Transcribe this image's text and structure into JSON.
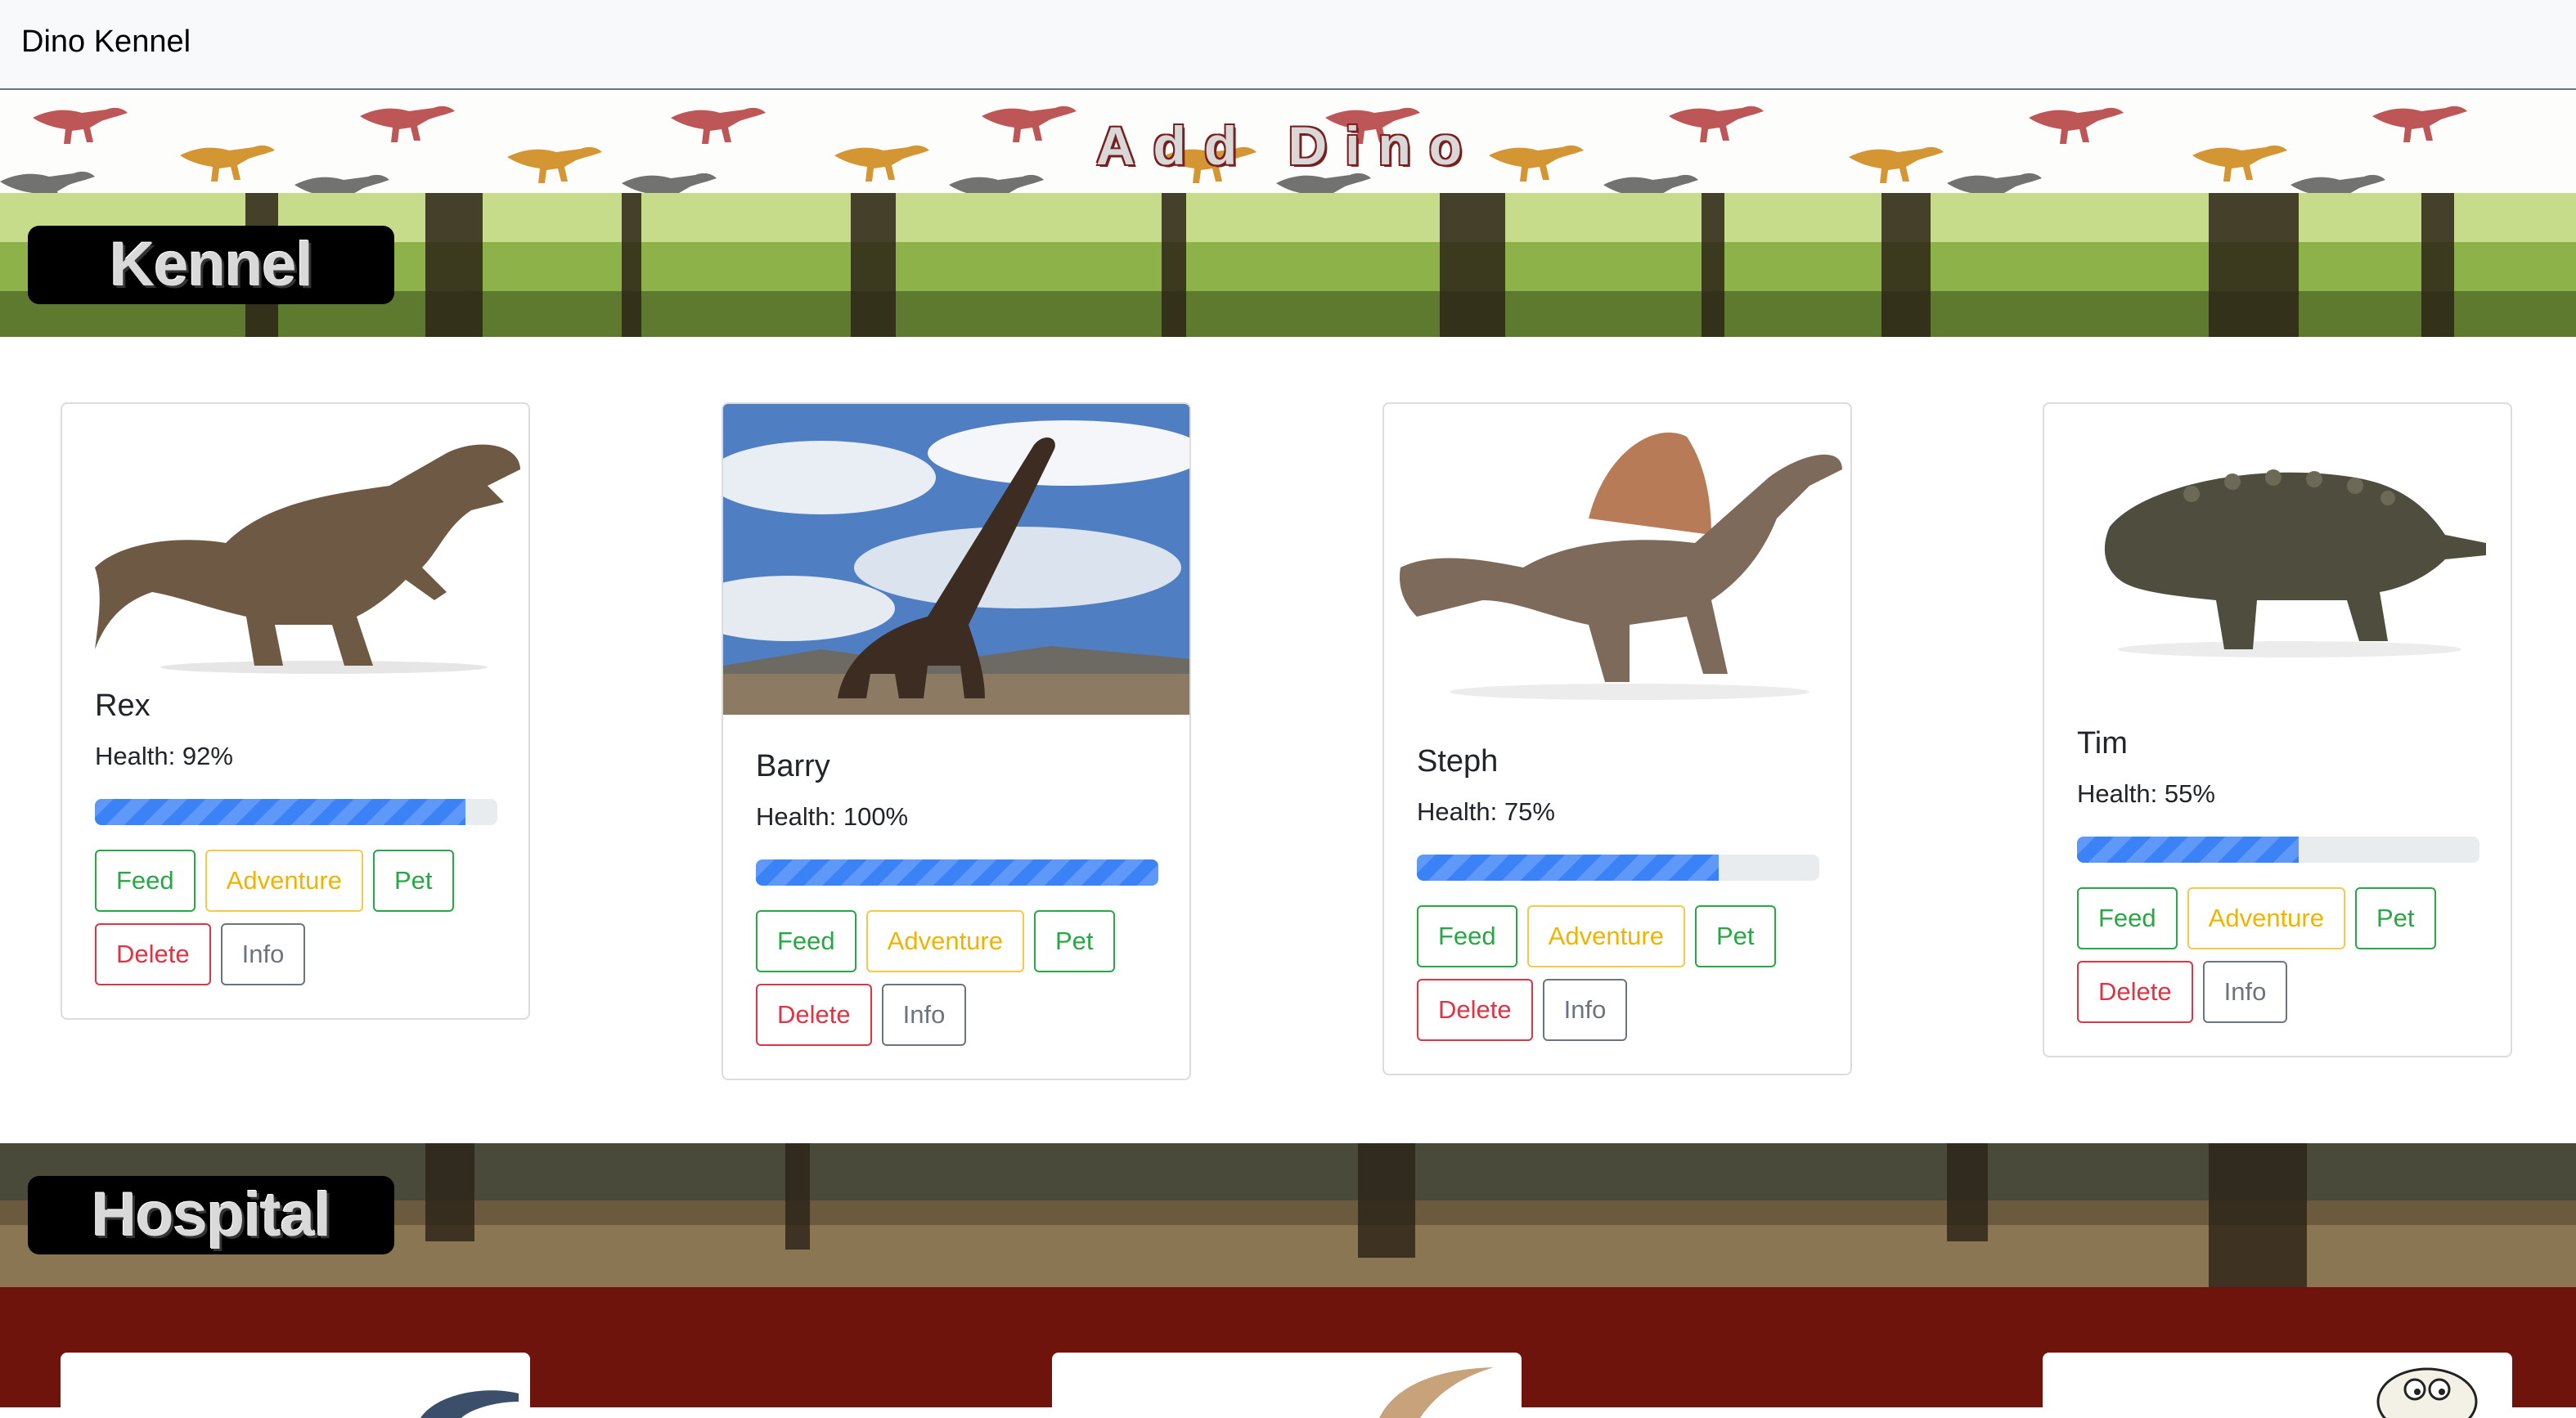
{
  "nav": {
    "brand": "Dino Kennel"
  },
  "add_dino": {
    "label": "Add Dino"
  },
  "kennel": {
    "title": "Kennel",
    "dinos": [
      {
        "name": "Rex",
        "health_text": "Health: 92%",
        "health": 92,
        "image": "t-rex-icon"
      },
      {
        "name": "Barry",
        "health_text": "Health: 100%",
        "health": 100,
        "image": "brachiosaurus-photo-icon"
      },
      {
        "name": "Steph",
        "health_text": "Health: 75%",
        "health": 75,
        "image": "spinosaurus-icon"
      },
      {
        "name": "Tim",
        "health_text": "Health: 55%",
        "health": 55,
        "image": "ankylosaurus-icon"
      }
    ]
  },
  "buttons": {
    "feed": "Feed",
    "adventure": "Adventure",
    "pet": "Pet",
    "delete": "Delete",
    "info": "Info"
  },
  "hospital": {
    "title": "Hospital"
  },
  "colors": {
    "primary": "#3b82f6",
    "success": "#28a745",
    "warning": "#f0b400",
    "danger": "#dc3545",
    "secondary": "#6c757d",
    "hospital_bg": "#6f130d"
  }
}
